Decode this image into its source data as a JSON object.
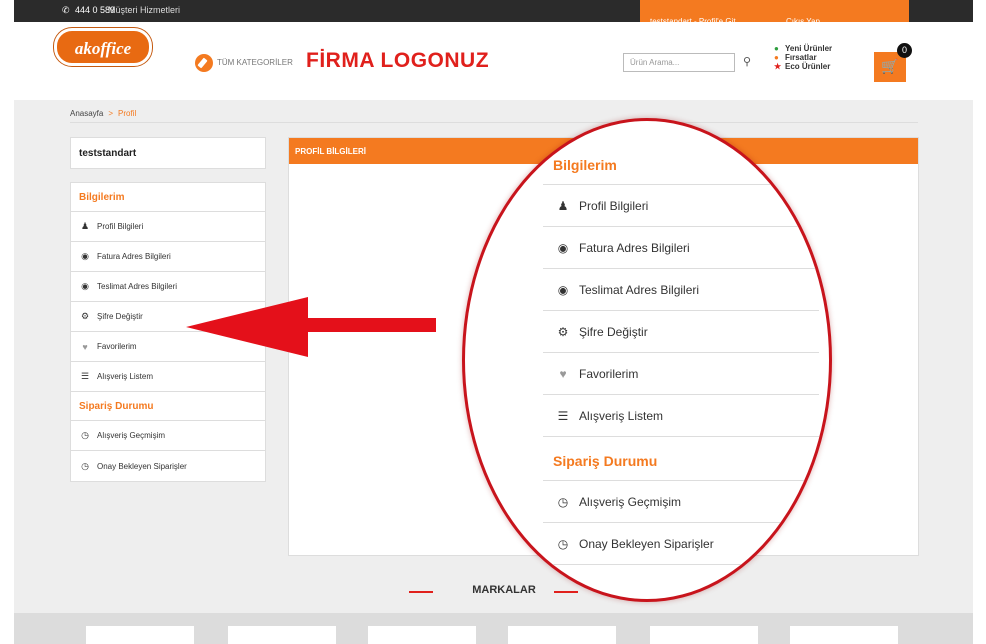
{
  "topbar": {
    "phone": "444 0 589",
    "hotline_label": "Müşteri Hizmetleri",
    "profile_link": "teststandart - Profil'e Git",
    "logout": "Çıkış Yap"
  },
  "header": {
    "logo_text": "akoffice",
    "categories_label": "TÜM KATEGORİLER",
    "firma_logo": "FİRMA LOGONUZ",
    "search_placeholder": "Ürün Arama...",
    "links": [
      "Yeni Ürünler",
      "Fırsatlar",
      "Eco Ürünler"
    ],
    "cart_count": "0"
  },
  "breadcrumb": {
    "home": "Anasayfa",
    "separator": ">",
    "current": "Profil"
  },
  "sidebar": {
    "username": "teststandart",
    "section1_title": "Bilgilerim",
    "items1": [
      {
        "label": "Profil Bilgileri",
        "icon": "user-icon"
      },
      {
        "label": "Fatura Adres Bilgileri",
        "icon": "address-icon"
      },
      {
        "label": "Teslimat Adres Bilgileri",
        "icon": "address-icon"
      },
      {
        "label": "Şifre Değiştir",
        "icon": "gears-icon"
      },
      {
        "label": "Favorilerim",
        "icon": "heart-icon"
      },
      {
        "label": "Alışveriş Listem",
        "icon": "list-icon"
      }
    ],
    "section2_title": "Sipariş Durumu",
    "items2": [
      {
        "label": "Alışveriş Geçmişim",
        "icon": "clock-icon"
      },
      {
        "label": "Onay Bekleyen Siparişler",
        "icon": "clock-icon"
      }
    ]
  },
  "panel": {
    "title": "PROFİL BİLGİLERİ"
  },
  "zoom": {
    "section1_title": "Bilgilerim",
    "items1": [
      "Profil Bilgileri",
      "Fatura Adres Bilgileri",
      "Teslimat Adres Bilgileri",
      "Şifre Değiştir",
      "Favorilerim",
      "Alışveriş Listem"
    ],
    "section2_title": "Sipariş Durumu",
    "items2": [
      "Alışveriş Geçmişim",
      "Onay Bekleyen Siparişler"
    ]
  },
  "brands_title": "MARKALAR",
  "colors": {
    "accent": "#f47a20",
    "arrow": "#e4101a",
    "topbar": "#2b2b2b"
  }
}
